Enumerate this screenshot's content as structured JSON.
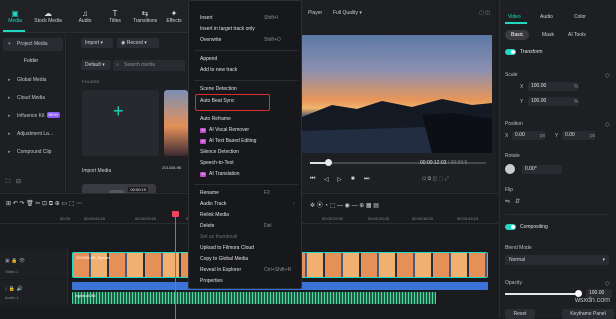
{
  "toolbar": {
    "items": [
      {
        "label": "Media",
        "icon": "media-icon",
        "icon_glyph": "▣"
      },
      {
        "label": "Stock Media",
        "icon": "cloud-icon",
        "icon_glyph": "☁"
      },
      {
        "label": "Audio",
        "icon": "music-icon",
        "icon_glyph": "♫"
      },
      {
        "label": "Titles",
        "icon": "text-icon",
        "icon_glyph": "T"
      },
      {
        "label": "Transitions",
        "icon": "transitions-icon",
        "icon_glyph": "⇆"
      },
      {
        "label": "Effects",
        "icon": "effects-icon",
        "icon_glyph": "✦"
      }
    ],
    "active": "Media"
  },
  "sidebar": {
    "items": [
      "Project Media",
      "Global Media",
      "Cloud Media",
      "Influence Kit",
      "Adjustment La...",
      "Compound Clip"
    ],
    "folder": "Folder",
    "badge": "NEW"
  },
  "media": {
    "import_label": "Import",
    "record_label": "Record",
    "default_label": "Default",
    "search_placeholder": "Search media",
    "folders_label": "FOLDER",
    "import_tile_label": "Import Media",
    "clip_label": "201308-96",
    "audio_duration": "00:00:19"
  },
  "player": {
    "label": "Player",
    "quality": "Full Quality",
    "timecode": "00:00:12:03",
    "total": "/ 00:00:5",
    "controls": [
      "⏮",
      "◁",
      "▷",
      "■",
      "⏭"
    ]
  },
  "properties": {
    "tabs": [
      "Video",
      "Audio",
      "Color"
    ],
    "subtabs": [
      "Basic",
      "Mask",
      "AI Tools"
    ],
    "transform": "Transform",
    "scale": "Scale",
    "scale_x": "100.00",
    "scale_y": "100.00",
    "scale_unit": "%",
    "x_label": "X",
    "y_label": "Y",
    "position": "Position",
    "pos_x": "0.00",
    "pos_y": "0.00",
    "pos_unit": "px",
    "rotate": "Rotate",
    "rotate_value": "0.00°",
    "flip": "Flip",
    "compositing": "Compositing",
    "blend_mode": "Blend Mode",
    "blend_value": "Normal",
    "opacity": "Opacity",
    "opacity_value": "100.00",
    "reset": "Reset",
    "keyframe": "Keyframe Panel"
  },
  "timeline": {
    "ticks": [
      "00:00",
      "00:00:04:25",
      "00:00:09:20",
      "00:00:14:15",
      "00:00:19:10",
      "00:00:24:05",
      "00:00:29:00",
      "00:00:33:25",
      "00:00:38:20",
      "00:00:43:15"
    ],
    "video_track": "Video 1",
    "audio_track": "Audio 1",
    "video_clip": "201308-96_Sunset",
    "audio_clip": "nightcall-96"
  },
  "context_menu": {
    "items": [
      {
        "label": "Insert",
        "shortcut": "Shift+I"
      },
      {
        "label": "Insert in target track only",
        "shortcut": ""
      },
      {
        "label": "Overwrite",
        "shortcut": "Shift+O"
      },
      {
        "label": "Append",
        "shortcut": ""
      },
      {
        "label": "Add to new track",
        "shortcut": ""
      },
      {
        "label": "Scene Detection",
        "shortcut": ""
      },
      {
        "label": "Auto Beat Sync",
        "shortcut": ""
      },
      {
        "label": "Auto Reframe",
        "shortcut": ""
      },
      {
        "label": "AI Vocal Remover",
        "shortcut": ""
      },
      {
        "label": "AI Text Based Editing",
        "shortcut": ""
      },
      {
        "label": "Silence Detection",
        "shortcut": ""
      },
      {
        "label": "Speech-to-Text",
        "shortcut": ""
      },
      {
        "label": "AI Translation",
        "shortcut": ""
      },
      {
        "label": "Rename",
        "shortcut": "F2"
      },
      {
        "label": "Audio Track",
        "shortcut": ""
      },
      {
        "label": "Relink Media",
        "shortcut": ""
      },
      {
        "label": "Delete",
        "shortcut": "Del"
      },
      {
        "label": "Set as thumbnail",
        "shortcut": ""
      },
      {
        "label": "Upload to Filmora Cloud",
        "shortcut": ""
      },
      {
        "label": "Copy to Global Media",
        "shortcut": ""
      },
      {
        "label": "Reveal In Explorer",
        "shortcut": "Ctrl+Shift+R"
      },
      {
        "label": "Properties",
        "shortcut": ""
      }
    ],
    "ai_badge": "AI"
  },
  "watermark": "wsxdn.com",
  "colors": {
    "accent": "#20d9c0",
    "highlight": "#e02b2b",
    "playhead": "#f0445a"
  }
}
